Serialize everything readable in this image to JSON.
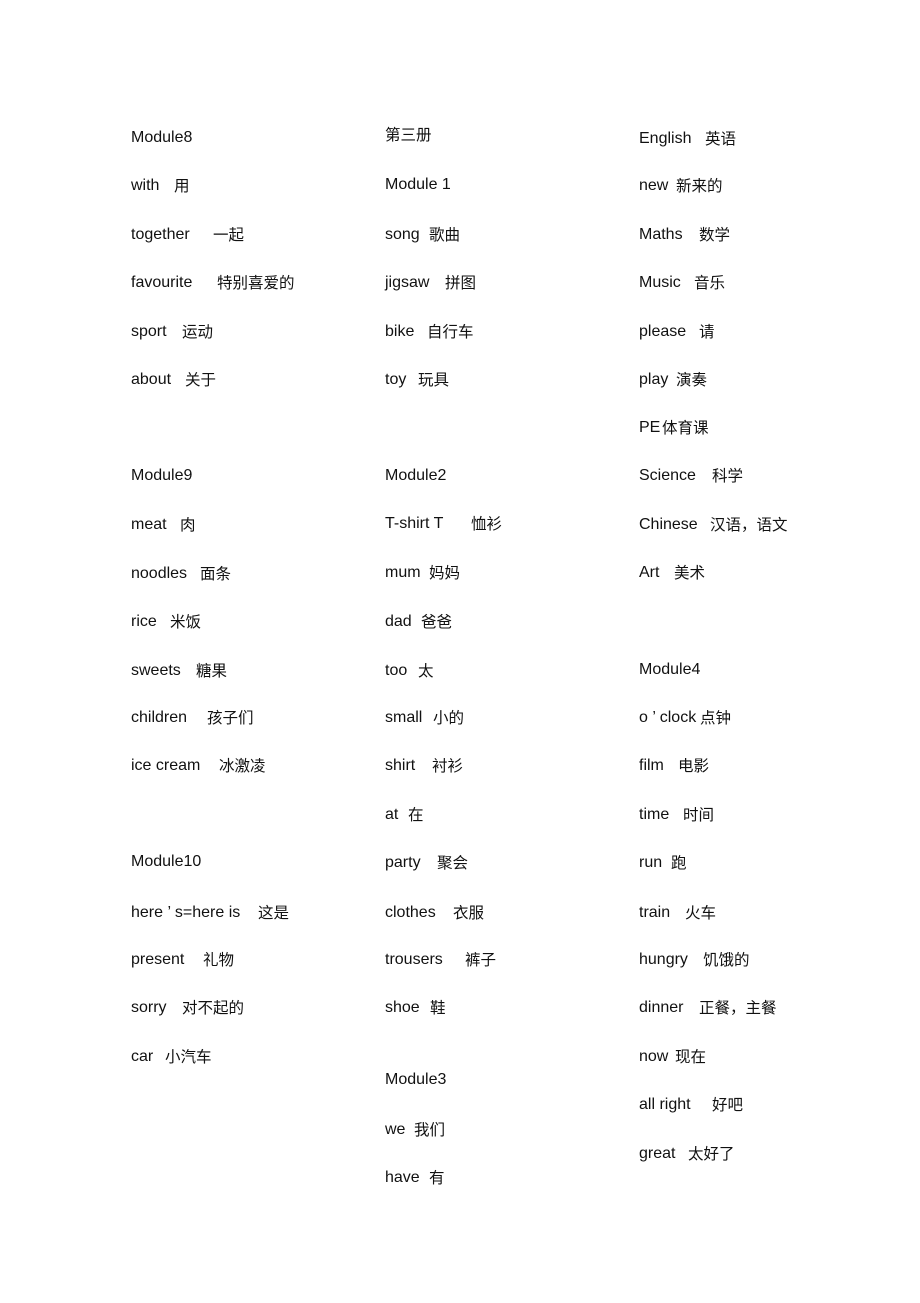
{
  "columns": [
    {
      "entries": [
        {
          "en": "Module8",
          "zh": ""
        },
        {
          "en": "with",
          "zh": "用"
        },
        {
          "en": "together",
          "zh": "一起"
        },
        {
          "en": "favourite",
          "zh": "特别喜爱的"
        },
        {
          "en": "sport",
          "zh": "运动"
        },
        {
          "en": "about",
          "zh": "关于"
        },
        {
          "en": "Module9",
          "zh": ""
        },
        {
          "en": "meat",
          "zh": "肉"
        },
        {
          "en": "noodles",
          "zh": "面条"
        },
        {
          "en": "rice",
          "zh": "米饭"
        },
        {
          "en": "sweets",
          "zh": "糖果"
        },
        {
          "en": "children",
          "zh": "孩子们"
        },
        {
          "en": "ice cream",
          "zh": "冰激凌"
        },
        {
          "en": "Module10",
          "zh": ""
        },
        {
          "en": "here  ’  s=here is",
          "zh": "这是"
        },
        {
          "en": "present",
          "zh": "礼物"
        },
        {
          "en": "sorry",
          "zh": "对不起的"
        },
        {
          "en": "car",
          "zh": "小汽车"
        }
      ]
    },
    {
      "entries": [
        {
          "en": "",
          "zh": "第三册"
        },
        {
          "en": "Module 1",
          "zh": ""
        },
        {
          "en": "song",
          "zh": "歌曲"
        },
        {
          "en": "jigsaw",
          "zh": "拼图"
        },
        {
          "en": "bike",
          "zh": "自行车"
        },
        {
          "en": "toy",
          "zh": "玩具"
        },
        {
          "en": "Module2",
          "zh": ""
        },
        {
          "en": "T-shirt T",
          "zh": "恤衫"
        },
        {
          "en": "mum",
          "zh": "妈妈"
        },
        {
          "en": "dad",
          "zh": "爸爸"
        },
        {
          "en": "too",
          "zh": "太"
        },
        {
          "en": "small",
          "zh": "小的"
        },
        {
          "en": "shirt",
          "zh": "衬衫"
        },
        {
          "en": "at",
          "zh": "在"
        },
        {
          "en": "party",
          "zh": "聚会"
        },
        {
          "en": "clothes",
          "zh": "衣服"
        },
        {
          "en": "trousers",
          "zh": "裤子"
        },
        {
          "en": "shoe",
          "zh": "鞋"
        },
        {
          "en": "Module3",
          "zh": ""
        },
        {
          "en": "we",
          "zh": "我们"
        },
        {
          "en": "have",
          "zh": "有"
        }
      ]
    },
    {
      "entries": [
        {
          "en": "English",
          "zh": "英语"
        },
        {
          "en": "new",
          "zh": "新来的"
        },
        {
          "en": "Maths",
          "zh": "数学"
        },
        {
          "en": "Music",
          "zh": "音乐"
        },
        {
          "en": "please",
          "zh": "请"
        },
        {
          "en": "play",
          "zh": "演奏"
        },
        {
          "en": "PE",
          "zh": "体育课"
        },
        {
          "en": "Science",
          "zh": "科学"
        },
        {
          "en": "Chinese",
          "zh": "汉语，语文"
        },
        {
          "en": "Art",
          "zh": "美术"
        },
        {
          "en": "Module4",
          "zh": ""
        },
        {
          "en": "o  ’  clock",
          "zh": "点钟"
        },
        {
          "en": "film",
          "zh": "电影"
        },
        {
          "en": "time",
          "zh": "时间"
        },
        {
          "en": "run",
          "zh": "跑"
        },
        {
          "en": "train",
          "zh": "火车"
        },
        {
          "en": "hungry",
          "zh": "饥饿的"
        },
        {
          "en": "dinner",
          "zh": "正餐，主餐"
        },
        {
          "en": "now",
          "zh": "现在"
        },
        {
          "en": "all right",
          "zh": "好吧"
        },
        {
          "en": "great",
          "zh": "太好了"
        }
      ]
    }
  ]
}
